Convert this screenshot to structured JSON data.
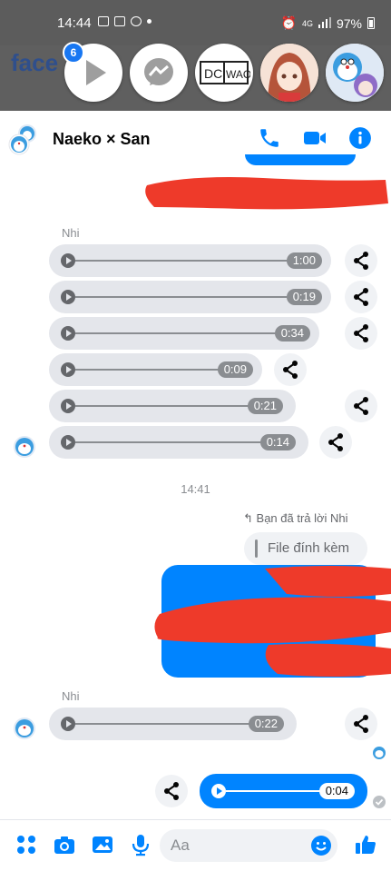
{
  "status_bar": {
    "time": "14:44",
    "network": "4G",
    "battery": "97%"
  },
  "background_app": {
    "partial_text": "face"
  },
  "chat_heads": [
    {
      "name": "play-app",
      "badge": "6"
    },
    {
      "name": "messenger"
    },
    {
      "name": "dcwao",
      "text": "DCWAO"
    },
    {
      "name": "anime-avatar"
    },
    {
      "name": "doraemon-avatar"
    }
  ],
  "header": {
    "title": "Naeko × San"
  },
  "messages": {
    "sender_1": "Nhi",
    "audio_group_1": [
      {
        "duration": "1:00"
      },
      {
        "duration": "0:19"
      },
      {
        "duration": "0:34"
      },
      {
        "duration": "0:09"
      },
      {
        "duration": "0:21"
      },
      {
        "duration": "0:14"
      }
    ],
    "timestamp": "14:41",
    "reply_hint": "Bạn đã trả lời Nhi",
    "quoted_text": "File đính kèm",
    "sender_2": "Nhi",
    "audio_incoming": {
      "duration": "0:22"
    },
    "audio_outgoing": {
      "duration": "0:04"
    }
  },
  "composer": {
    "placeholder": "Aa"
  },
  "colors": {
    "accent": "#0084ff",
    "messenger_blue": "#1877f2",
    "redaction": "#ee3a2a",
    "bubble": "#e4e6eb"
  }
}
